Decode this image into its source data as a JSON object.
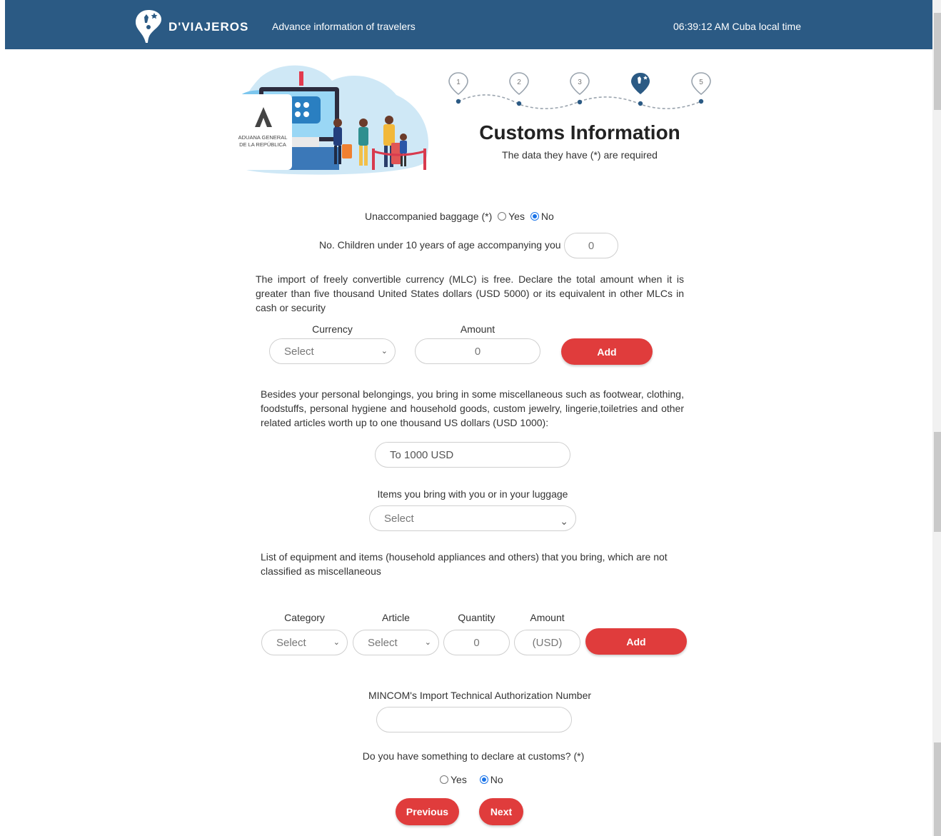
{
  "header": {
    "brand": "D'VIAJEROS",
    "subtitle": "Advance information of travelers",
    "time": "06:39:12 AM Cuba local time"
  },
  "hero": {
    "badge_line1": "ADUANA GENERAL",
    "badge_line2": "DE LA REPÚBLICA",
    "steps": [
      "1",
      "2",
      "3",
      "4",
      "5"
    ],
    "active_step": 4,
    "title": "Customs Information",
    "subtitle": "The data they have (*) are required"
  },
  "baggage": {
    "label": "Unaccompanied baggage (*)",
    "yes": "Yes",
    "no": "No",
    "selected": "No"
  },
  "children": {
    "label": "No. Children under 10 years of age accompanying you",
    "value": "0"
  },
  "currency_note": "The import of freely convertible currency (MLC) is free. Declare the total amount when it is greater than five thousand United States dollars (USD 5000) or its equivalent in other MLCs in cash or security",
  "currency_form": {
    "currency_label": "Currency",
    "currency_value": "Select",
    "amount_label": "Amount",
    "amount_value": "0",
    "add_label": "Add"
  },
  "misc_note": "Besides your personal belongings, you bring in some miscellaneous such as footwear, clothing, foodstuffs, personal hygiene and household goods, custom jewelry, lingerie,toiletries and other related articles worth up to one thousand US dollars (USD 1000):",
  "misc_field": {
    "value": "To 1000 USD"
  },
  "items": {
    "label": "Items you bring with you or in your luggage",
    "value": "Select"
  },
  "equipment_note": "List of equipment and items (household appliances and others) that you bring, which are not classified as miscellaneous",
  "equipment_form": {
    "category_label": "Category",
    "category_value": "Select",
    "article_label": "Article",
    "article_value": "Select",
    "quantity_label": "Quantity",
    "quantity_value": "0",
    "amount_label": "Amount",
    "amount_placeholder": "(USD)",
    "add_label": "Add"
  },
  "mincom": {
    "label": "MINCOM's Import Technical Authorization Number",
    "value": ""
  },
  "declare": {
    "label": "Do you have something to declare at customs? (*)",
    "yes": "Yes",
    "no": "No",
    "selected": "No"
  },
  "nav": {
    "previous": "Previous",
    "next": "Next"
  },
  "colors": {
    "header": "#2b5a84",
    "accent": "#e03c3c",
    "radio": "#1a73e8"
  }
}
